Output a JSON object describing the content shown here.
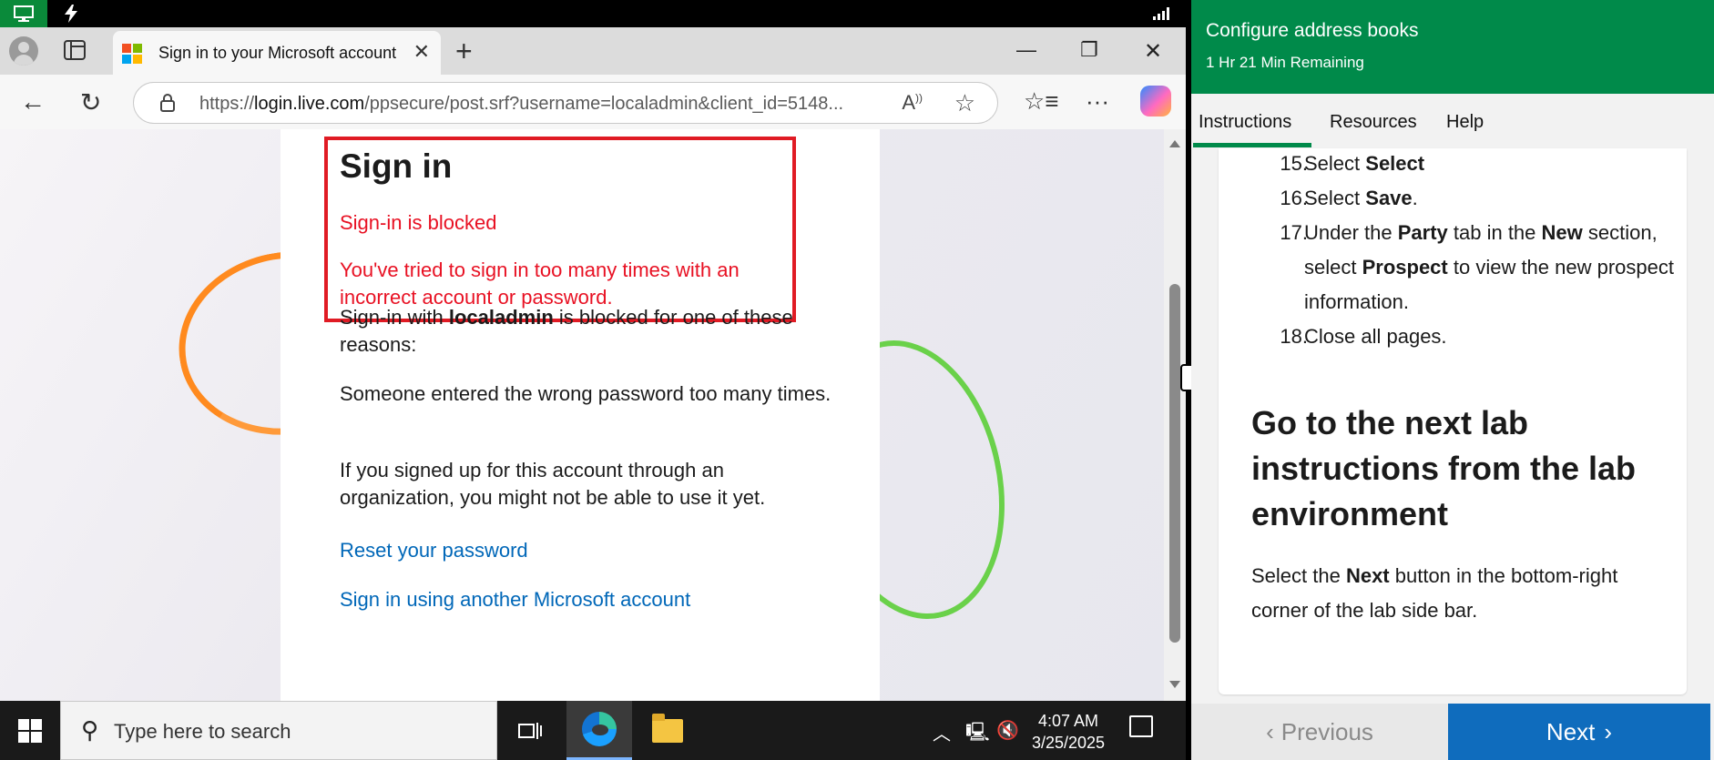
{
  "browser": {
    "tab_title": "Sign in to your Microsoft account",
    "url_prefix": "https://",
    "url_host": "login.live.com",
    "url_rest": "/ppsecure/post.srf?username=localadmin&client_id=5148...",
    "read_aloud_label": "Aͅ"
  },
  "signin": {
    "title": "Sign in",
    "blocked": "Sign-in is blocked",
    "tried": "You've tried to sign in too many times with an incorrect account or password.",
    "reason_prefix": "Sign-in with ",
    "reason_user": "localadmin",
    "reason_suffix": " is blocked for one of these reasons:",
    "reason1": "Someone entered the wrong password too many times.",
    "reason2": "If you signed up for this account through an organization, you might not be able to use it yet.",
    "link_reset": "Reset your password",
    "link_other": "Sign in using another Microsoft account"
  },
  "taskbar": {
    "search_placeholder": "Type here to search",
    "time": "4:07 AM",
    "date": "3/25/2025"
  },
  "lab": {
    "title": "Configure address books",
    "remaining": "1 Hr 21 Min Remaining",
    "tabs": [
      "Instructions",
      "Resources",
      "Help"
    ],
    "steps": [
      {
        "num": "15.",
        "pre": "Select ",
        "bold": "Select",
        "post": ""
      },
      {
        "num": "16.",
        "pre": "Select ",
        "bold": "Save",
        "post": "."
      },
      {
        "num": "17.",
        "pre": "Under the ",
        "bold": "Party",
        "mid": " tab in the ",
        "bold2": "New",
        "mid2": " section, select ",
        "bold3": "Prospect",
        "post": " to view the new prospect information."
      },
      {
        "num": "18.",
        "pre": "Close all pages.",
        "bold": "",
        "post": ""
      }
    ],
    "heading": "Go to the next lab instructions from the lab environment",
    "para_pre": "Select the ",
    "para_bold": "Next",
    "para_post": " button in the bottom-right corner of the lab side bar.",
    "prev_label": "Previous",
    "next_label": "Next",
    "accent": "#008a4a",
    "next_color": "#0f6cbd"
  },
  "colors": {
    "error_red": "#e81123",
    "link_blue": "#0067b8",
    "highlight_red": "#e01b24"
  }
}
